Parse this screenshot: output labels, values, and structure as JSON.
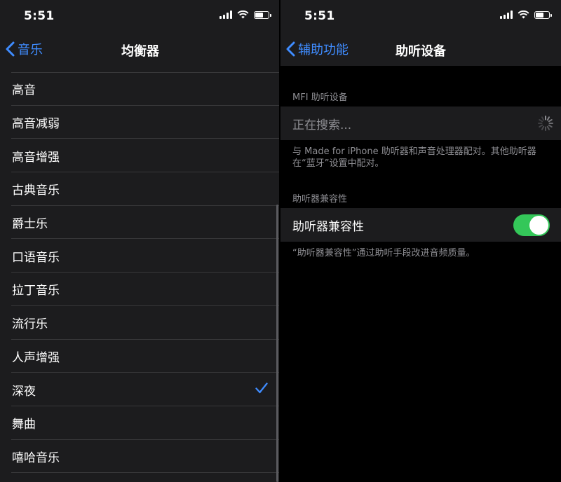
{
  "left": {
    "status": {
      "time": "5:51"
    },
    "nav": {
      "back_label": "音乐",
      "title": "均衡器"
    },
    "items": [
      {
        "label": "高音"
      },
      {
        "label": "高音减弱"
      },
      {
        "label": "高音增强"
      },
      {
        "label": "古典音乐"
      },
      {
        "label": "爵士乐"
      },
      {
        "label": "口语音乐"
      },
      {
        "label": "拉丁音乐"
      },
      {
        "label": "流行乐"
      },
      {
        "label": "人声增强"
      },
      {
        "label": "深夜",
        "selected": true
      },
      {
        "label": "舞曲"
      },
      {
        "label": "嘻哈音乐"
      }
    ]
  },
  "right": {
    "status": {
      "time": "5:51"
    },
    "nav": {
      "back_label": "辅助功能",
      "title": "助听设备"
    },
    "mfi": {
      "header": "MFI 助听设备",
      "searching_label": "正在搜索...",
      "footer": "与 Made for iPhone 助听器和声音处理器配对。其他助听器在“蓝牙”设置中配对。"
    },
    "compat": {
      "header": "助听器兼容性",
      "label": "助听器兼容性",
      "toggle_on": true,
      "footer": "“助听器兼容性”通过助听手段改进音频质量。"
    }
  },
  "colors": {
    "accent": "#3f8cff",
    "toggle_on": "#34c759",
    "secondary_text": "#8e8e93"
  }
}
